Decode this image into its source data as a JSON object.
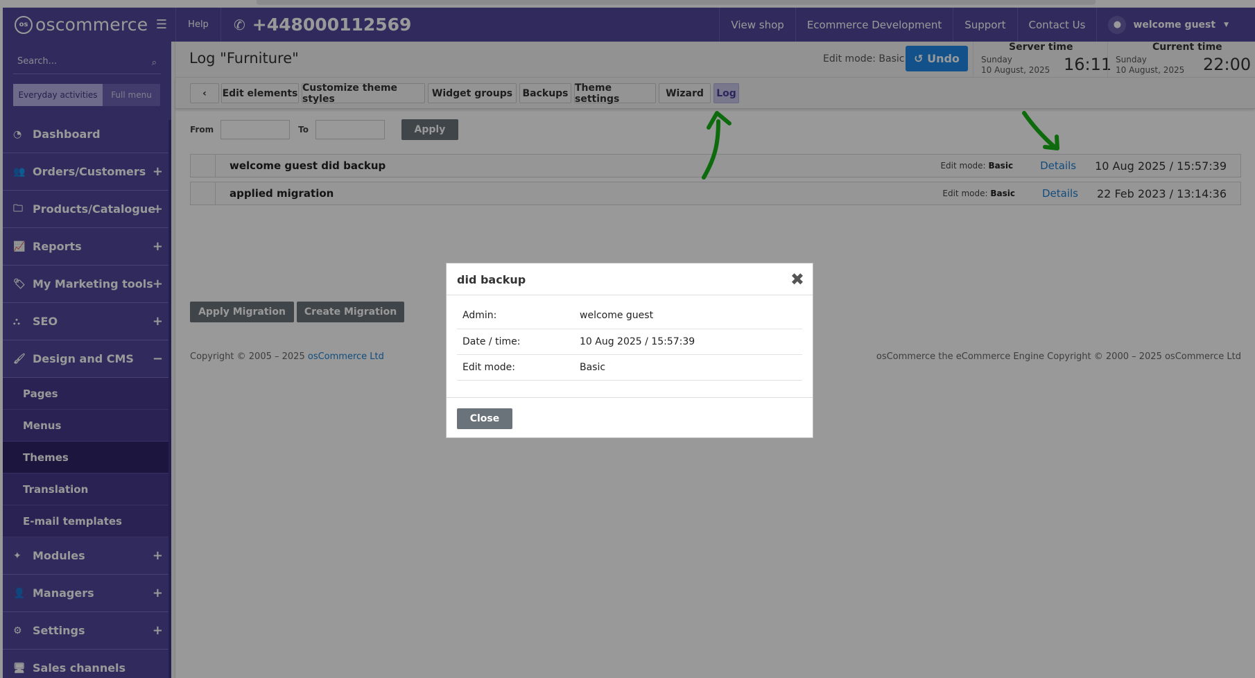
{
  "header": {
    "logo_text": "oscommerce",
    "help": "Help",
    "phone": "+448000112569",
    "nav": [
      "View shop",
      "Ecommerce Development",
      "Support",
      "Contact Us"
    ],
    "user": "welcome guest",
    "brand_color": "#53469c"
  },
  "sidebar": {
    "search_placeholder": "Search...",
    "toggle_everyday": "Everyday activities",
    "toggle_full": "Full menu",
    "items": [
      {
        "label": "Dashboard",
        "icon": "dashboard-icon"
      },
      {
        "label": "Orders/Customers",
        "icon": "users-icon"
      },
      {
        "label": "Products/Catalogue",
        "icon": "folder-icon"
      },
      {
        "label": "Reports",
        "icon": "chart-line-icon"
      },
      {
        "label": "My Marketing tools",
        "icon": "tag-icon"
      },
      {
        "label": "SEO",
        "icon": "sitemap-icon"
      },
      {
        "label": "Design and CMS",
        "icon": "brush-icon"
      },
      {
        "label": "Modules",
        "icon": "puzzle-icon"
      },
      {
        "label": "Managers",
        "icon": "user-icon"
      },
      {
        "label": "Settings",
        "icon": "cogs-icon"
      },
      {
        "label": "Sales channels",
        "icon": "monitor-icon"
      }
    ],
    "design_sub": [
      "Pages",
      "Menus",
      "Themes",
      "Translation",
      "E-mail templates"
    ]
  },
  "page": {
    "title": "Log \"Furniture\"",
    "edit_mode_label": "Edit mode: Basic",
    "undo": "Undo",
    "server_time": {
      "label": "Server time",
      "day": "Sunday",
      "date": "10 August, 2025",
      "time": "16:11"
    },
    "current_time": {
      "label": "Current time",
      "day": "Sunday",
      "date": "10 August, 2025",
      "time": "22:00"
    }
  },
  "toolbar": {
    "back": "‹",
    "tabs": [
      "Edit elements",
      "Customize theme styles",
      "Widget groups",
      "Backups",
      "Theme settings",
      "Wizard",
      "Log"
    ]
  },
  "filter": {
    "from": "From",
    "to": "To",
    "apply": "Apply"
  },
  "log_rows": [
    {
      "text": "welcome guest did backup",
      "edit_mode_prefix": "Edit mode:",
      "edit_mode": "Basic",
      "details": "Details",
      "datetime": "10 Aug 2025 / 15:57:39"
    },
    {
      "text": "applied migration",
      "edit_mode_prefix": "Edit mode:",
      "edit_mode": "Basic",
      "details": "Details",
      "datetime": "22 Feb 2023 / 13:14:36"
    }
  ],
  "buttons": {
    "apply_migration": "Apply Migration",
    "create_migration": "Create Migration"
  },
  "footer": {
    "left_prefix": "Copyright © 2005 – 2025 ",
    "left_link": "osCommerce Ltd",
    "right": "osCommerce the eCommerce Engine Copyright © 2000 – 2025 osCommerce Ltd"
  },
  "modal": {
    "title": "did backup",
    "rows": [
      {
        "key": "Admin:",
        "value": "welcome guest"
      },
      {
        "key": "Date / time:",
        "value": "10 Aug 2025 / 15:57:39"
      },
      {
        "key": "Edit mode:",
        "value": "Basic"
      }
    ],
    "close": "Close"
  }
}
